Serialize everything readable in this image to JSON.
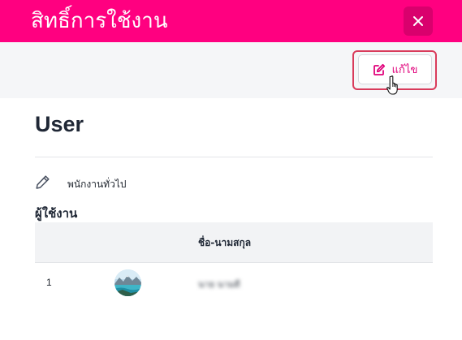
{
  "modal": {
    "title": "สิทธิ์การใช้งาน",
    "close_icon": "close-icon",
    "header_color": "#ff0080"
  },
  "toolbar": {
    "edit_label": "แก้ไข",
    "edit_icon": "edit-icon",
    "accent_color": "#e0007a"
  },
  "role": {
    "name": "User",
    "description": "พนักงานทั่วไป",
    "description_icon": "pencil-icon"
  },
  "users_section": {
    "label": "ผู้ใช้งาน",
    "columns": [
      "",
      "",
      "ชื่อ-นามสกุล"
    ],
    "rows": [
      {
        "index": "1",
        "avatar": "avatar-photo",
        "name": "นาย นามดี"
      }
    ]
  }
}
